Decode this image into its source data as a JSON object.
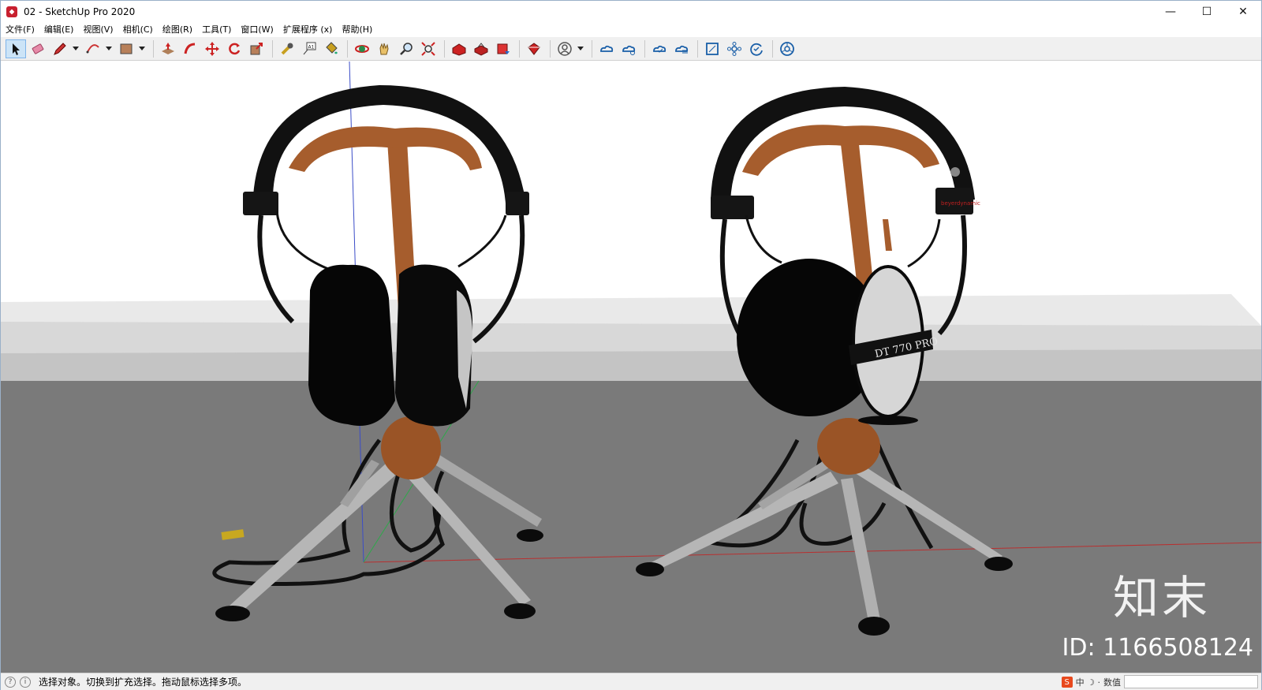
{
  "window": {
    "title": "02 - SketchUp Pro 2020",
    "minimize": "—",
    "maximize": "☐",
    "close": "✕"
  },
  "menu": {
    "items": [
      "文件(F)",
      "编辑(E)",
      "视图(V)",
      "相机(C)",
      "绘图(R)",
      "工具(T)",
      "窗口(W)",
      "扩展程序 (x)",
      "帮助(H)"
    ]
  },
  "toolbar": {
    "tools": [
      {
        "icon": "select-arrow-icon",
        "active": true
      },
      {
        "icon": "eraser-icon"
      },
      {
        "icon": "pencil-line-icon"
      },
      {
        "icon": "arc-icon"
      },
      {
        "icon": "rectangle-icon"
      },
      {
        "icon": "push-pull-icon"
      },
      {
        "icon": "follow-me-icon"
      },
      {
        "icon": "move-icon"
      },
      {
        "icon": "rotate-icon"
      },
      {
        "icon": "scale-icon"
      },
      {
        "icon": "tape-measure-icon"
      },
      {
        "icon": "text-icon"
      },
      {
        "icon": "paint-bucket-icon"
      },
      {
        "icon": "orbit-icon"
      },
      {
        "icon": "pan-icon"
      },
      {
        "icon": "zoom-icon"
      },
      {
        "icon": "zoom-extents-icon"
      },
      {
        "icon": "warehouse-icon"
      },
      {
        "icon": "share-model-icon"
      },
      {
        "icon": "layout-icon"
      },
      {
        "icon": "extension-warehouse-icon"
      },
      {
        "icon": "account-icon"
      },
      {
        "icon": "trimble-connect-icon"
      },
      {
        "icon": "cloud-sync-icon"
      },
      {
        "icon": "cloud-check-icon"
      },
      {
        "icon": "cloud-list-icon"
      },
      {
        "icon": "frame-icon"
      },
      {
        "icon": "components-icon"
      },
      {
        "icon": "refresh-check-icon"
      },
      {
        "icon": "browser-icon"
      }
    ]
  },
  "viewport": {
    "watermark_logo": "知末",
    "watermark_id": "ID: 1166508124",
    "model_label_right": "DT 770 PRO"
  },
  "status": {
    "message": "选择对象。切换到扩充选择。拖动鼠标选择多项。",
    "measurements_label": "数值",
    "ime_text": "中 ☽ ·"
  },
  "colors": {
    "sky": "#ffffff",
    "ground": "#7a7a7a",
    "wood": "#a0592a",
    "headphone": "#0d0d0d",
    "leg": "#b8b8b8"
  }
}
